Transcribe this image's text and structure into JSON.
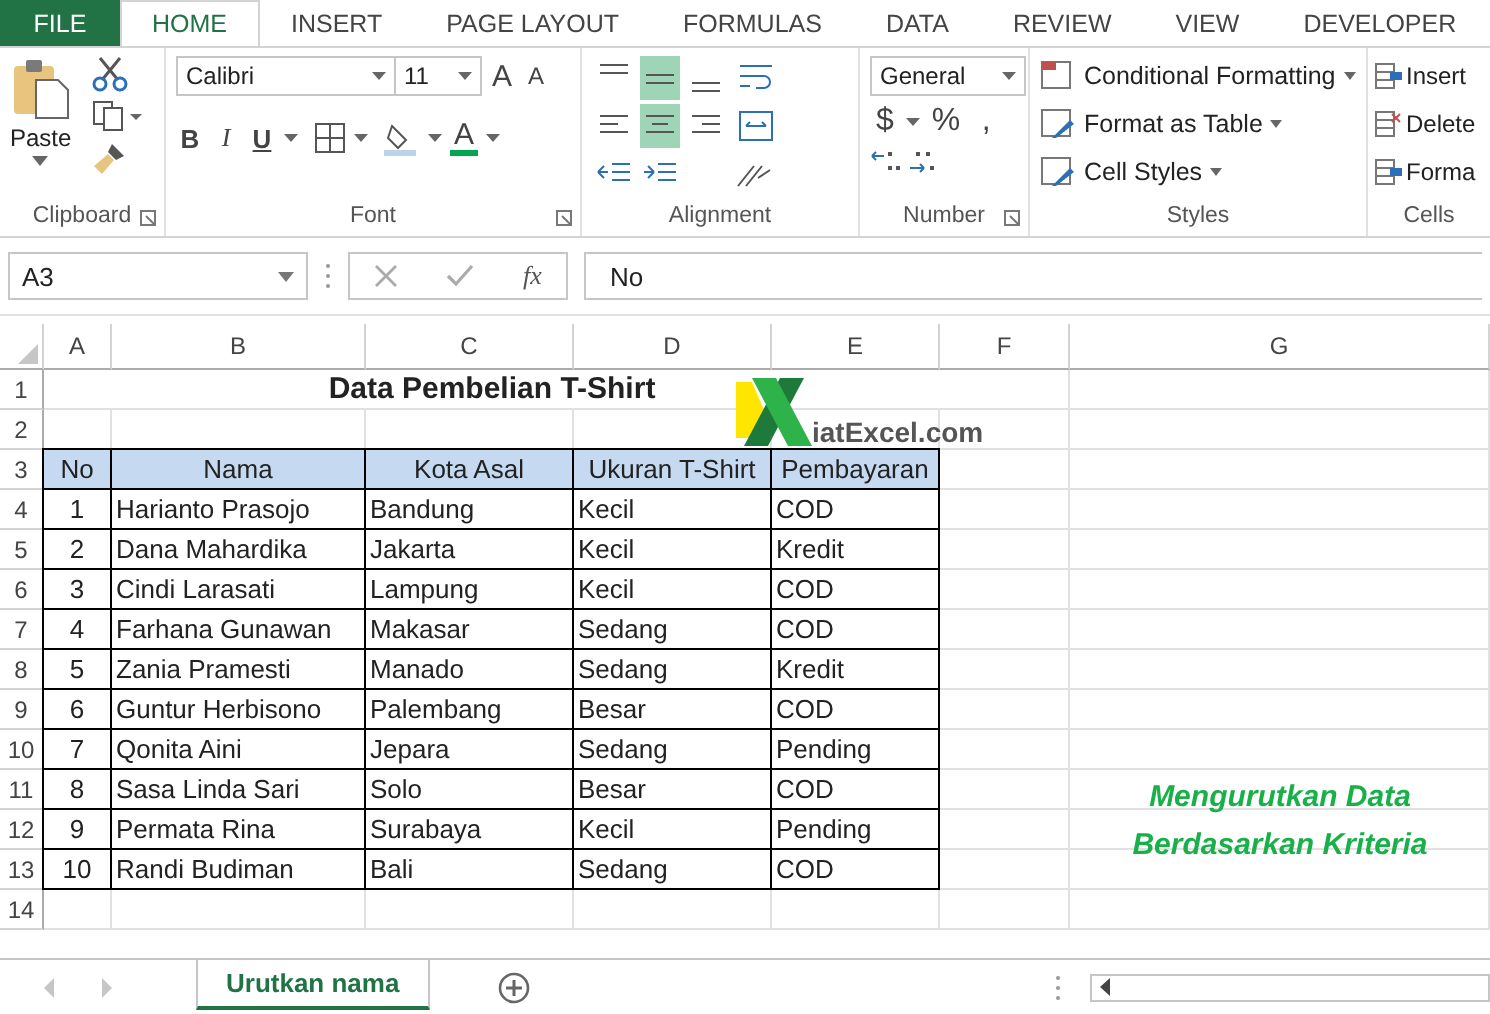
{
  "ribbon_tabs": [
    {
      "label": "FILE",
      "kind": "file",
      "selected": false
    },
    {
      "label": "HOME",
      "kind": "tab",
      "selected": true
    },
    {
      "label": "INSERT",
      "kind": "tab",
      "selected": false
    },
    {
      "label": "PAGE LAYOUT",
      "kind": "tab",
      "selected": false
    },
    {
      "label": "FORMULAS",
      "kind": "tab",
      "selected": false
    },
    {
      "label": "DATA",
      "kind": "tab",
      "selected": false
    },
    {
      "label": "REVIEW",
      "kind": "tab",
      "selected": false
    },
    {
      "label": "VIEW",
      "kind": "tab",
      "selected": false
    },
    {
      "label": "DEVELOPER",
      "kind": "tab",
      "selected": false
    }
  ],
  "ribbon": {
    "clipboard": {
      "label": "Clipboard",
      "paste": "Paste"
    },
    "font": {
      "label": "Font",
      "name": "Calibri",
      "size": "11",
      "grow": "A",
      "shrink": "A",
      "bold": "B",
      "italic": "I",
      "underline": "U",
      "font_color": "A"
    },
    "alignment": {
      "label": "Alignment",
      "vertical": [
        {
          "selected": false
        },
        {
          "selected": true
        },
        {
          "selected": false
        }
      ],
      "horizontal": [
        {
          "selected": false
        },
        {
          "selected": true
        },
        {
          "selected": false
        }
      ]
    },
    "number": {
      "label": "Number",
      "format": "General",
      "currency": "$",
      "percent": "%",
      "comma": ","
    },
    "styles": {
      "label": "Styles",
      "buttons": [
        "Conditional Formatting",
        "Format as Table",
        "Cell Styles"
      ]
    },
    "cells": {
      "label": "Cells",
      "buttons": [
        "Insert",
        "Delete",
        "Forma"
      ]
    }
  },
  "formula_bar": {
    "name_box": "A3",
    "function_label": "fx",
    "formula": "No"
  },
  "sheet": {
    "columns": [
      "A",
      "B",
      "C",
      "D",
      "E",
      "F",
      "G"
    ],
    "row_numbers": [
      "1",
      "2",
      "3",
      "4",
      "5",
      "6",
      "7",
      "8",
      "9",
      "10",
      "11",
      "12",
      "13",
      "14"
    ],
    "title": "Data Pembelian T-Shirt",
    "logo_text": "iatExcel.com",
    "table_header": [
      "No",
      "Nama",
      "Kota Asal",
      "Ukuran T-Shirt",
      "Pembayaran"
    ],
    "table_rows": [
      [
        "1",
        "Harianto Prasojo",
        "Bandung",
        "Kecil",
        "COD"
      ],
      [
        "2",
        "Dana Mahardika",
        "Jakarta",
        "Kecil",
        "Kredit"
      ],
      [
        "3",
        "Cindi Larasati",
        "Lampung",
        "Kecil",
        "COD"
      ],
      [
        "4",
        "Farhana Gunawan",
        "Makasar",
        "Sedang",
        "COD"
      ],
      [
        "5",
        "Zania Pramesti",
        "Manado",
        "Sedang",
        "Kredit"
      ],
      [
        "6",
        "Guntur Herbisono",
        "Palembang",
        "Besar",
        "COD"
      ],
      [
        "7",
        "Qonita Aini",
        "Jepara",
        "Sedang",
        "Pending"
      ],
      [
        "8",
        "Sasa Linda Sari",
        "Solo",
        "Besar",
        "COD"
      ],
      [
        "9",
        "Permata Rina",
        "Surabaya",
        "Kecil",
        "Pending"
      ],
      [
        "10",
        "Randi Budiman",
        "Bali",
        "Sedang",
        "COD"
      ]
    ],
    "note": [
      "Mengurutkan Data",
      "Berdasarkan Kriteria"
    ]
  },
  "sheet_tabs": [
    {
      "label": "Urutkan nama",
      "selected": true
    }
  ]
}
